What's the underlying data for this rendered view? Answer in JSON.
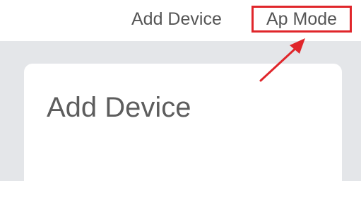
{
  "header": {
    "title": "Add Device",
    "ap_mode_label": "Ap Mode"
  },
  "card": {
    "title": "Add Device"
  },
  "colors": {
    "highlight": "#e0262b",
    "background": "#e4e6e9",
    "text": "#555555"
  },
  "annotation": {
    "icon": "arrow-pointer-icon"
  }
}
